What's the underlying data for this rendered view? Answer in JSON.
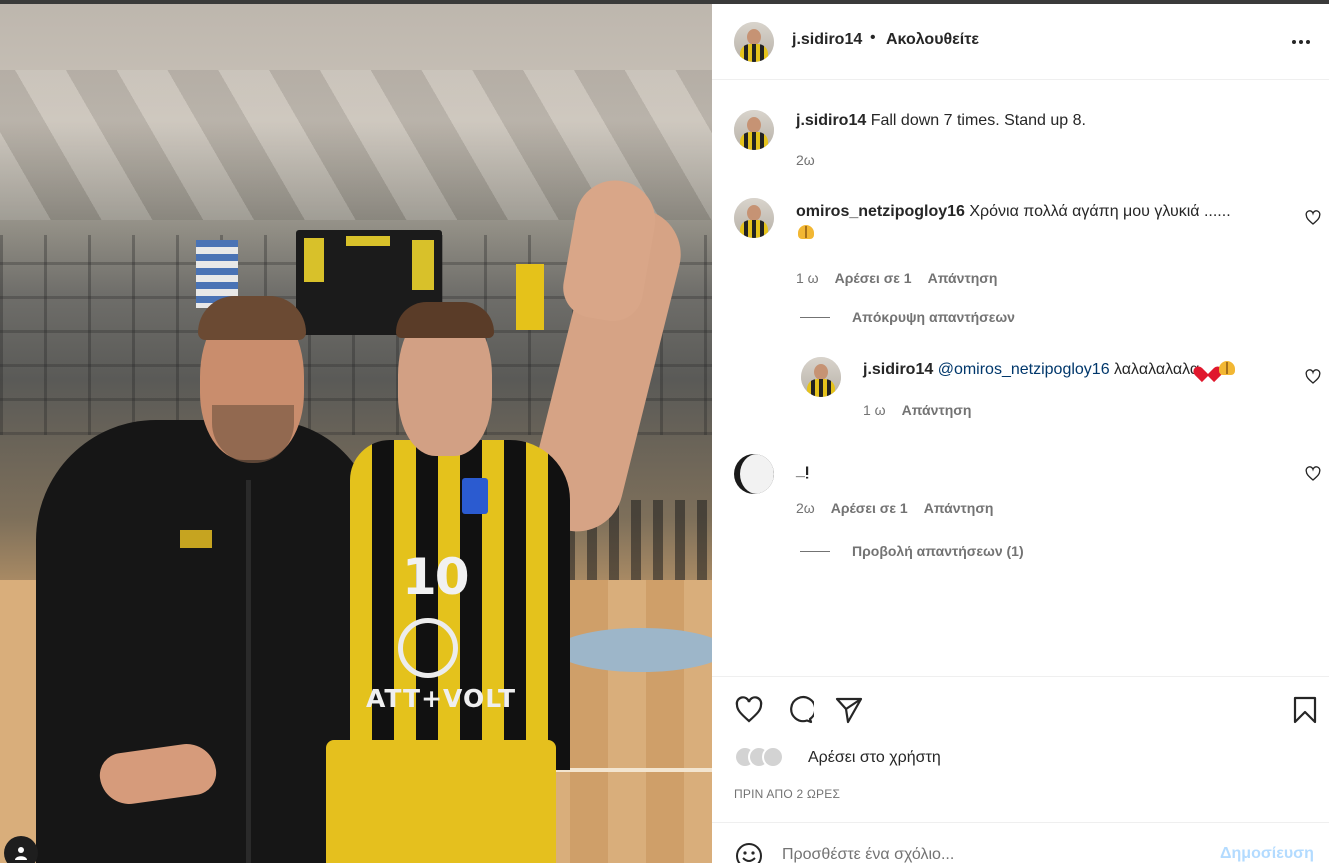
{
  "post": {
    "author": "j.sidiro14",
    "separator": "•",
    "follow_status": "Ακολουθείτε",
    "caption": "Fall down 7 times. Stand up 8.",
    "caption_age": "2ω",
    "likes_text": "Αρέσει στο χρήστη",
    "posted_ago": "ΠΡΙΝ ΑΠΟ 2 ΩΡΕΣ",
    "jersey_number": "10",
    "jersey_sponsor": "ATT+VOLT"
  },
  "comments": [
    {
      "user": "omiros_netzipogloy16",
      "text": "Χρόνια πολλά αγάπη μου γλυκιά ......",
      "age": "1 ω",
      "likes": "Αρέσει σε 1",
      "reply_label": "Απάντηση",
      "replies_toggle": "Απόκρυψη απαντήσεων",
      "replies": [
        {
          "user": "j.sidiro14",
          "mention": "@omiros_netzipogloy16",
          "text": "λαλαλαλαλα",
          "age": "1 ω",
          "reply_label": "Απάντηση"
        }
      ]
    },
    {
      "user": "_ᴉ",
      "text": "",
      "age": "2ω",
      "likes": "Αρέσει σε 1",
      "reply_label": "Απάντηση",
      "replies_toggle": "Προβολή απαντήσεων (1)"
    }
  ],
  "composer": {
    "placeholder": "Προσθέστε ένα σχόλιο...",
    "post_label": "Δημοσίευση"
  },
  "icons": {
    "like": "heart-icon",
    "comment": "comment-icon",
    "share": "send-icon",
    "save": "bookmark-icon",
    "more": "more-icon",
    "emoji": "emoji-icon"
  },
  "colors": {
    "text": "#262626",
    "secondary": "#737373",
    "link": "#00376b",
    "post_button_disabled": "#b3dbff",
    "jersey_yellow": "#e4c21c"
  }
}
